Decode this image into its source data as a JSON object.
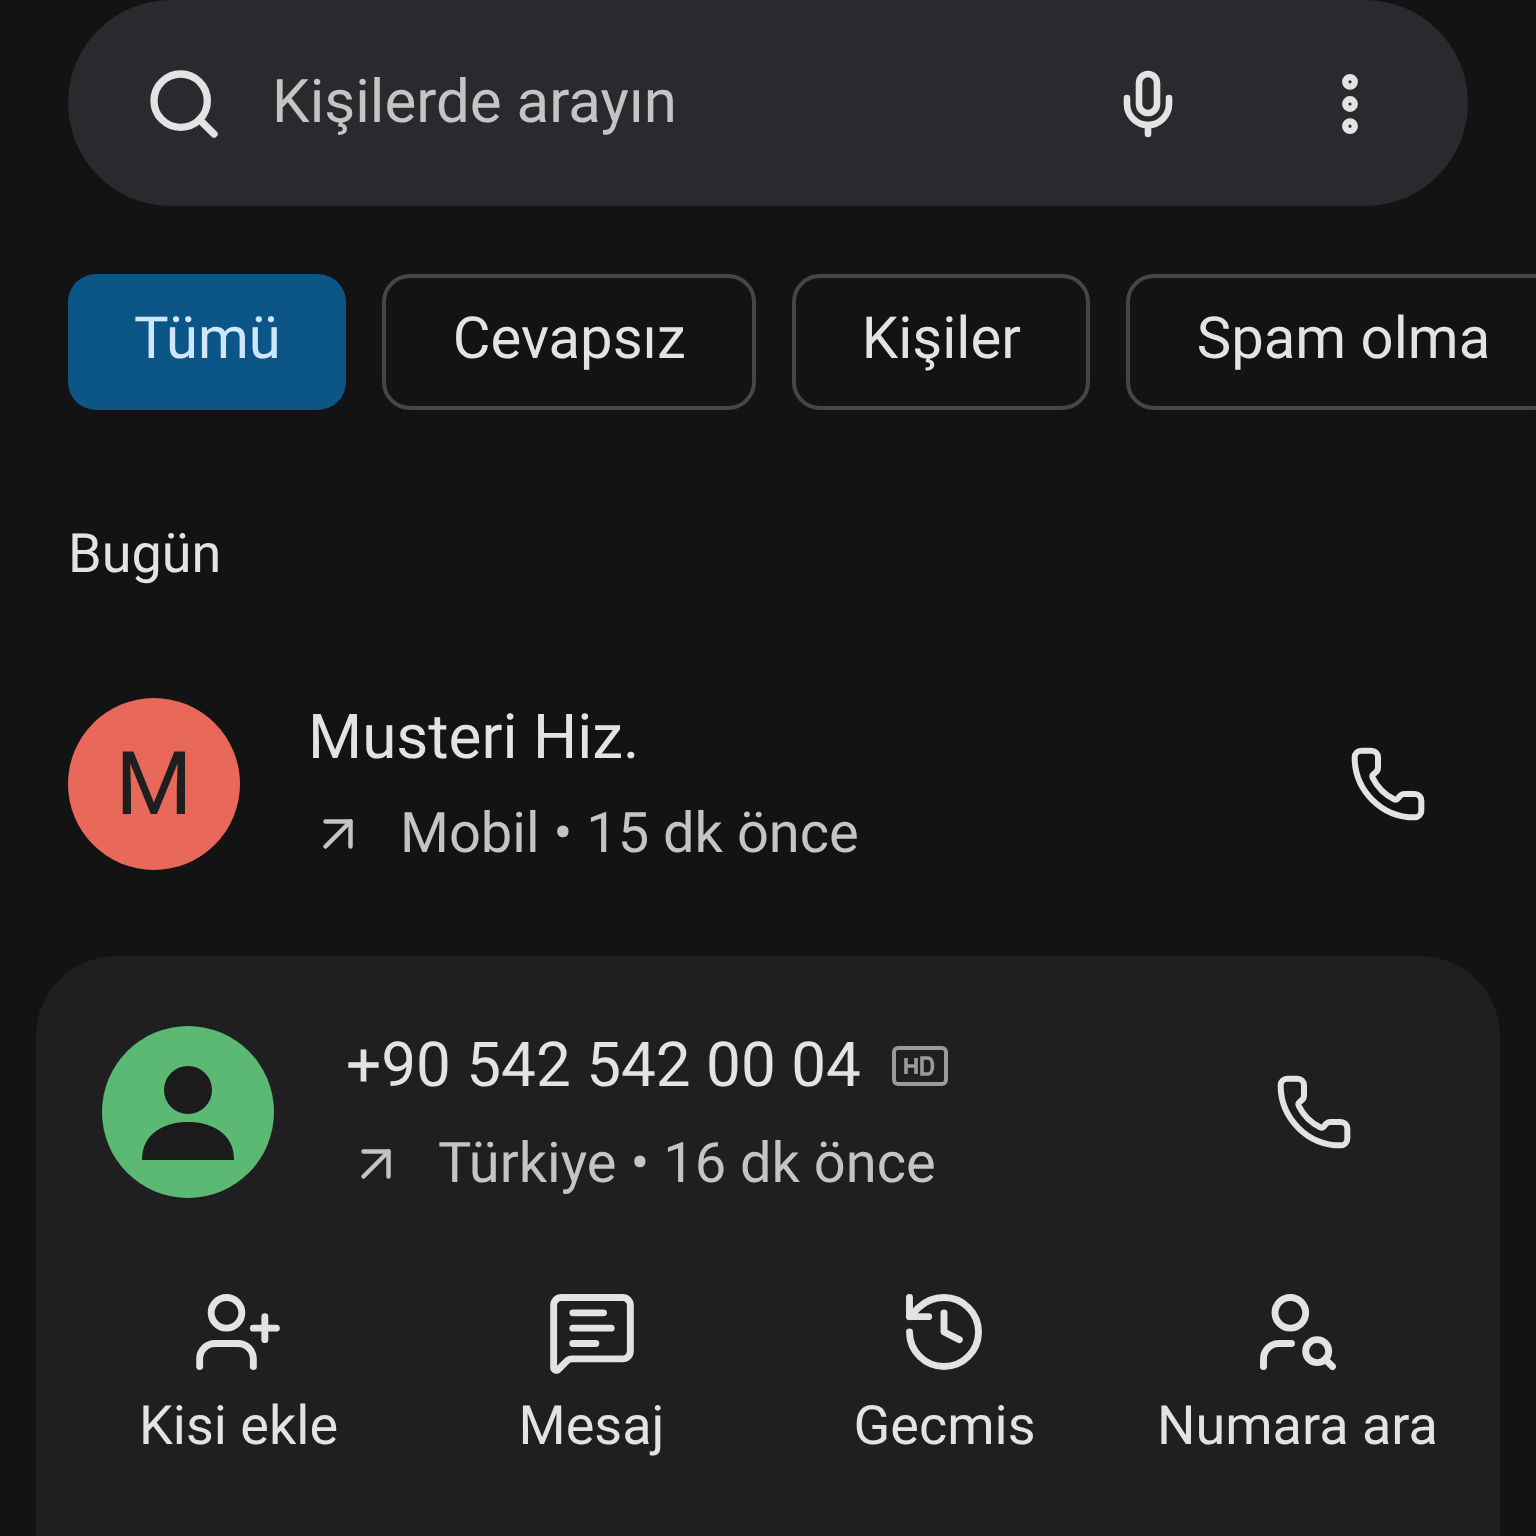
{
  "search": {
    "placeholder": "Kişilerde arayın"
  },
  "filters": [
    {
      "label": "Tümü",
      "selected": true
    },
    {
      "label": "Cevapsız",
      "selected": false
    },
    {
      "label": "Kişiler",
      "selected": false
    },
    {
      "label": "Spam olma",
      "selected": false
    }
  ],
  "section": "Bugün",
  "calls": [
    {
      "name": "Musteri Hiz.",
      "avatar": {
        "kind": "letter",
        "letter": "M",
        "color": "#e8685a"
      },
      "hd": false,
      "detail": "Mobil • 15 dk önce",
      "expanded": false
    },
    {
      "name": "+90 542 542 00 04",
      "avatar": {
        "kind": "person",
        "color": "#5bb974"
      },
      "hd": true,
      "detail": "Türkiye • 16 dk önce",
      "expanded": true
    }
  ],
  "actions": [
    {
      "kind": "add-person",
      "label": "Kisi ekle"
    },
    {
      "kind": "message",
      "label": "Mesaj"
    },
    {
      "kind": "history",
      "label": "Gecmis"
    },
    {
      "kind": "search-person",
      "label": "Numara ara"
    }
  ]
}
